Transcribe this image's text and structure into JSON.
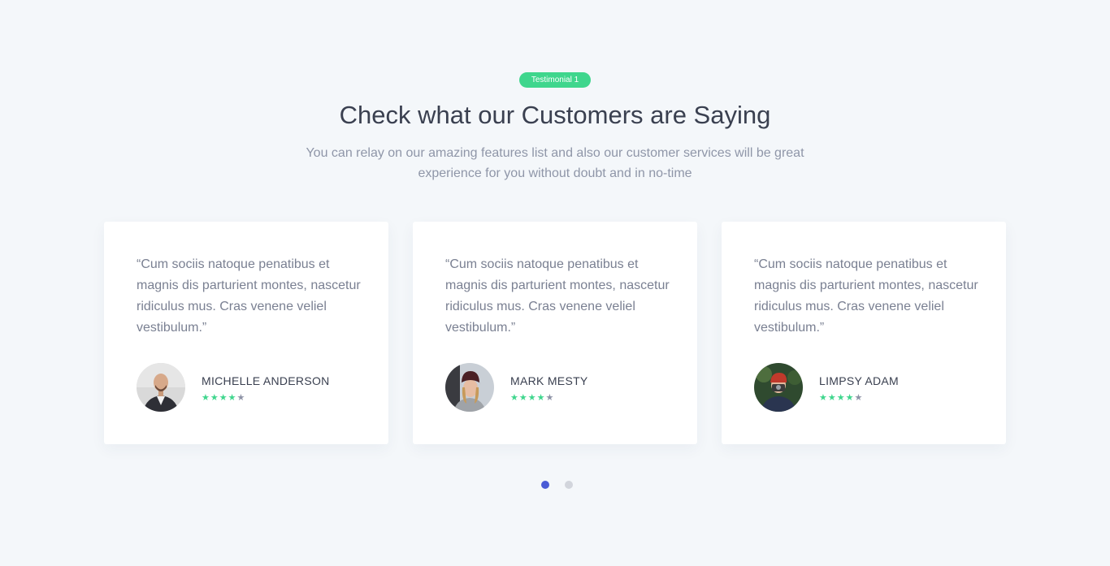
{
  "badge": "Testimonial 1",
  "title": "Check what our Customers are Saying",
  "subtitle": "You can relay on our amazing features list and also our customer services will be great experience for you without doubt and in no-time",
  "colors": {
    "accent_green": "#3fd68d",
    "accent_blue": "#4a5bd6",
    "background": "#f4f7fa"
  },
  "testimonials": [
    {
      "quote": "“Cum sociis natoque penatibus et magnis dis parturient montes, nascetur ridiculus mus. Cras venene veliel vestibulum.”",
      "name": "MICHELLE ANDERSON",
      "rating": 4,
      "rating_max": 5
    },
    {
      "quote": "“Cum sociis natoque penatibus et magnis dis parturient montes, nascetur ridiculus mus. Cras venene veliel vestibulum.”",
      "name": "MARK MESTY",
      "rating": 4,
      "rating_max": 5
    },
    {
      "quote": "“Cum sociis natoque penatibus et magnis dis parturient montes, nascetur ridiculus mus. Cras venene veliel vestibulum.”",
      "name": "LIMPSY ADAM",
      "rating": 4,
      "rating_max": 5
    }
  ],
  "pagination": {
    "pages": 2,
    "active": 1
  }
}
